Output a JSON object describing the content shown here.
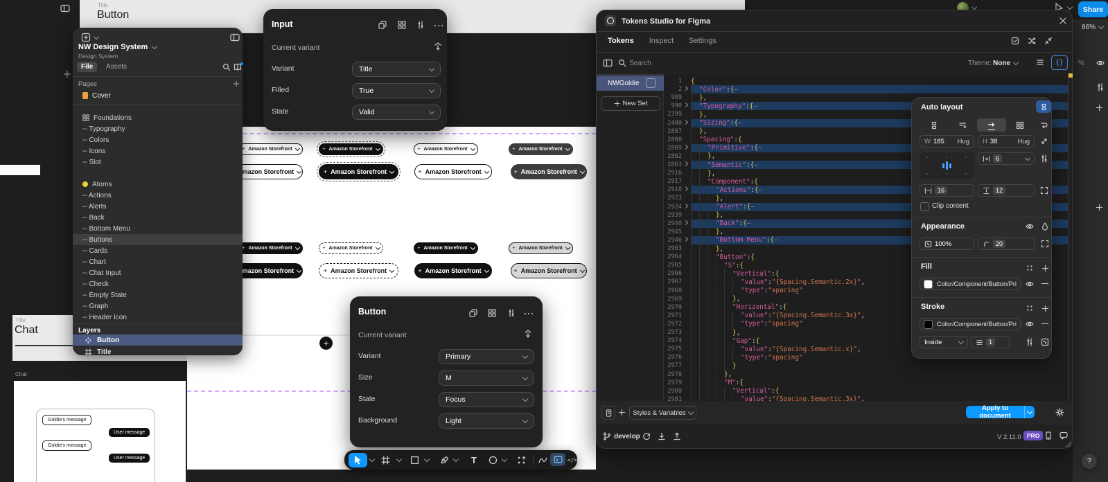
{
  "topbar": {
    "share_label": "Share",
    "zoom_level": "86%"
  },
  "canvas": {
    "button_section": {
      "eyebrow": "Title",
      "title": "Button"
    },
    "chat_section": {
      "eyebrow": "Title",
      "title": "Chat",
      "frame_label": "Chat",
      "messages": [
        {
          "from": "goldie",
          "text": "Goldie's message"
        },
        {
          "from": "user",
          "text": "User message"
        },
        {
          "from": "goldie",
          "text": "Goldie's message"
        },
        {
          "from": "user",
          "text": "User message"
        }
      ]
    },
    "storefront_button_label": "Amazon Storefront",
    "button_grid": {
      "rows": [
        {
          "size": "small",
          "variants": [
            "outline",
            "primary-focus",
            "outline",
            "dark"
          ]
        },
        {
          "size": "medium",
          "variants": [
            "outline",
            "primary-focus",
            "outline",
            "dark"
          ]
        },
        {
          "size": "small",
          "variants": [
            "primary",
            "outline-focus",
            "primary",
            "light"
          ]
        },
        {
          "size": "medium",
          "variants": [
            "primary",
            "outline-focus",
            "primary",
            "light"
          ]
        }
      ]
    }
  },
  "left_panel": {
    "file_name": "NW Design System",
    "file_subtitle": "Design System",
    "tabs": [
      {
        "label": "File",
        "active": true
      },
      {
        "label": "Assets",
        "active": false
      }
    ],
    "pages_label": "Pages",
    "pages": [
      {
        "icon": "cover",
        "label": "Cover"
      }
    ],
    "tree": [
      {
        "icon": "grid",
        "label": "Foundations"
      },
      {
        "label": "-- Typography"
      },
      {
        "label": "-- Colors"
      },
      {
        "label": "-- Icons"
      },
      {
        "label": "-- Slot"
      },
      {
        "icon": "yellow-dot",
        "label": "Atoms",
        "group_start": true
      },
      {
        "label": "-- Actions"
      },
      {
        "label": "-- Alerts"
      },
      {
        "label": "-- Back"
      },
      {
        "label": "-- Bottom Menu"
      },
      {
        "label": "-- Buttons",
        "highlighted": true
      },
      {
        "label": "-- Cards"
      },
      {
        "label": "-- Chart"
      },
      {
        "label": "-- Chat Input"
      },
      {
        "label": "-- Check"
      },
      {
        "label": "-- Empty State"
      },
      {
        "label": "-- Graph"
      },
      {
        "label": "-- Header Icon"
      }
    ],
    "layers_label": "Layers",
    "layers": [
      {
        "icon": "component",
        "label": "Button",
        "selected": true
      },
      {
        "icon": "frame",
        "label": "Title",
        "selected": false
      }
    ]
  },
  "input_panel": {
    "title": "Input",
    "current_variant_label": "Current variant",
    "rows": [
      {
        "label": "Variant",
        "value": "Title"
      },
      {
        "label": "Filled",
        "value": "True"
      },
      {
        "label": "State",
        "value": "Valid"
      }
    ]
  },
  "button_panel": {
    "title": "Button",
    "current_variant_label": "Current variant",
    "rows": [
      {
        "label": "Variant",
        "value": "Primary"
      },
      {
        "label": "Size",
        "value": "M"
      },
      {
        "label": "State",
        "value": "Focus"
      },
      {
        "label": "Background",
        "value": "Light"
      }
    ]
  },
  "plugin": {
    "window_title": "Tokens Studio for Figma",
    "tabs": [
      {
        "label": "Tokens",
        "active": true
      },
      {
        "label": "Inspect",
        "active": false
      },
      {
        "label": "Settings",
        "active": false
      }
    ],
    "search_placeholder": "Search",
    "theme_label": "Theme:",
    "theme_value": "None",
    "token_sets": [
      {
        "label": "NWGoldie",
        "selected": true
      }
    ],
    "new_set_label": "New Set",
    "editor_lines": [
      [
        1,
        0,
        "root"
      ],
      [
        2,
        1,
        "fold",
        "Color"
      ],
      [
        989,
        1,
        "close"
      ],
      [
        990,
        1,
        "fold",
        "Typography"
      ],
      [
        2399,
        1,
        "close"
      ],
      [
        2400,
        1,
        "fold",
        "Sizing"
      ],
      [
        2807,
        1,
        "close"
      ],
      [
        2808,
        1,
        "open",
        "Spacing"
      ],
      [
        2809,
        2,
        "fold",
        "Primitive"
      ],
      [
        2862,
        2,
        "close"
      ],
      [
        2863,
        2,
        "fold",
        "Semantic"
      ],
      [
        2916,
        2,
        "close"
      ],
      [
        2917,
        2,
        "open",
        "Component"
      ],
      [
        2918,
        3,
        "fold",
        "Actions"
      ],
      [
        2923,
        3,
        "close"
      ],
      [
        2924,
        3,
        "fold",
        "Alert"
      ],
      [
        2939,
        3,
        "close"
      ],
      [
        2940,
        3,
        "fold",
        "Back"
      ],
      [
        2945,
        3,
        "close"
      ],
      [
        2946,
        3,
        "fold",
        "Bottom Menu"
      ],
      [
        2963,
        3,
        "close"
      ],
      [
        2964,
        3,
        "open",
        "Button"
      ],
      [
        2965,
        4,
        "open",
        "S"
      ],
      [
        2966,
        5,
        "open",
        "Vertical"
      ],
      [
        2967,
        6,
        "kv",
        "value",
        "{Spacing.Semantic.2x}",
        1
      ],
      [
        2968,
        6,
        "kv",
        "type",
        "spacing",
        0
      ],
      [
        2969,
        5,
        "close"
      ],
      [
        2970,
        5,
        "open",
        "Horizontal"
      ],
      [
        2971,
        6,
        "kv",
        "value",
        "{Spacing.Semantic.3x}",
        1
      ],
      [
        2972,
        6,
        "kv",
        "type",
        "spacing",
        0
      ],
      [
        2973,
        5,
        "close"
      ],
      [
        2974,
        5,
        "open",
        "Gap"
      ],
      [
        2975,
        6,
        "kv",
        "value",
        "{Spacing.Semantic.x}",
        1
      ],
      [
        2976,
        6,
        "kv",
        "type",
        "spacing",
        0
      ],
      [
        2977,
        5,
        "close-plain"
      ],
      [
        2978,
        4,
        "close"
      ],
      [
        2979,
        4,
        "open",
        "M"
      ],
      [
        2980,
        5,
        "open",
        "Vertical"
      ],
      [
        2981,
        6,
        "kv",
        "value",
        "{Spacing.Semantic.3x}",
        1
      ]
    ],
    "footer": {
      "styles_button": "Styles & Variables",
      "apply_button": "Apply to document",
      "branch": "develop",
      "version": "V 2.11.0",
      "badge": "PRO"
    }
  },
  "design_panel": {
    "auto_layout": {
      "title": "Auto layout",
      "w_label": "W",
      "width": "185",
      "w_sizing": "Hug",
      "h_label": "H",
      "height": "38",
      "h_sizing": "Hug",
      "gap": "6",
      "padding_h": "16",
      "padding_v": "12",
      "clip_label": "Clip content"
    },
    "appearance": {
      "title": "Appearance",
      "opacity": "100%",
      "corner_radius": "20"
    },
    "fill": {
      "title": "Fill",
      "token": "Color/Component/Button/Prim...",
      "swatch": "#ffffff"
    },
    "stroke": {
      "title": "Stroke",
      "token": "Color/Component/Button/Prim...",
      "swatch": "#000000",
      "position": "Inside",
      "weight": "1"
    }
  },
  "right_strip": {
    "percent_hint": "%"
  },
  "help_label": "?",
  "colors": {
    "accent_blue": "#0d99ff",
    "selection_row": "#49557a",
    "code_highlight": "#1d3b5f",
    "pro_badge": "#6a4ec2",
    "marker_yellow": "#e2b93d",
    "purple_guide": "#d0a5ff",
    "cover_orange": "#e8a33d",
    "atoms_yellow": "#f0d030"
  }
}
